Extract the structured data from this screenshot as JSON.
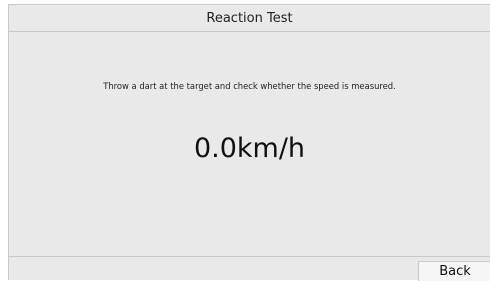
{
  "window": {
    "title": "Reaction Test"
  },
  "main": {
    "instruction": "Throw a dart at the target and check whether the speed is measured.",
    "speed_value": "0.0",
    "speed_unit": "km/h",
    "speed_display": "0.0km/h"
  },
  "footer": {
    "back_label": "Back"
  },
  "colors": {
    "background": "#e9e9e9",
    "divider": "#c9c9c9",
    "button_bg": "#f6f6f6"
  }
}
